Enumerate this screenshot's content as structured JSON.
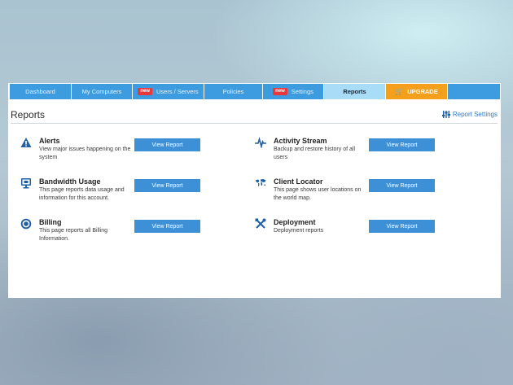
{
  "nav": {
    "tabs": [
      {
        "label": "Dashboard"
      },
      {
        "label": "My Computers"
      },
      {
        "label": "Users / Servers",
        "badge": "new"
      },
      {
        "label": "Policies"
      },
      {
        "label": "Settings",
        "badge": "new"
      },
      {
        "label": "Reports",
        "active": true
      },
      {
        "label": "UPGRADE"
      }
    ]
  },
  "header": {
    "title": "Reports",
    "settings_link": "Report Settings"
  },
  "reports": [
    {
      "title": "Alerts",
      "desc": "View major issues happening on the system",
      "button": "View Report",
      "icon": "alert-icon"
    },
    {
      "title": "Activity Stream",
      "desc": "Backup and restore history of all users",
      "button": "View Report",
      "icon": "activity-icon"
    },
    {
      "title": "Bandwidth Usage",
      "desc": "This page reports data usage and information for this account.",
      "button": "View Report",
      "icon": "monitor-icon"
    },
    {
      "title": "Client Locator",
      "desc": "This page shows user locations on the world map.",
      "button": "View Report",
      "icon": "world-map-icon"
    },
    {
      "title": "Billing",
      "desc": "This page reports all Billing Information.",
      "button": "View Report",
      "icon": "billing-icon"
    },
    {
      "title": "Deployment",
      "desc": "Deployment reports",
      "button": "View Report",
      "icon": "tools-icon"
    }
  ],
  "colors": {
    "tab_bg": "#3d9be0",
    "tab_active_bg": "#a9dcf7",
    "upgrade_bg": "#f4a01c",
    "button_bg": "#3d8fd6",
    "icon_color": "#1f5fa8",
    "badge_bg": "#e8383b"
  }
}
